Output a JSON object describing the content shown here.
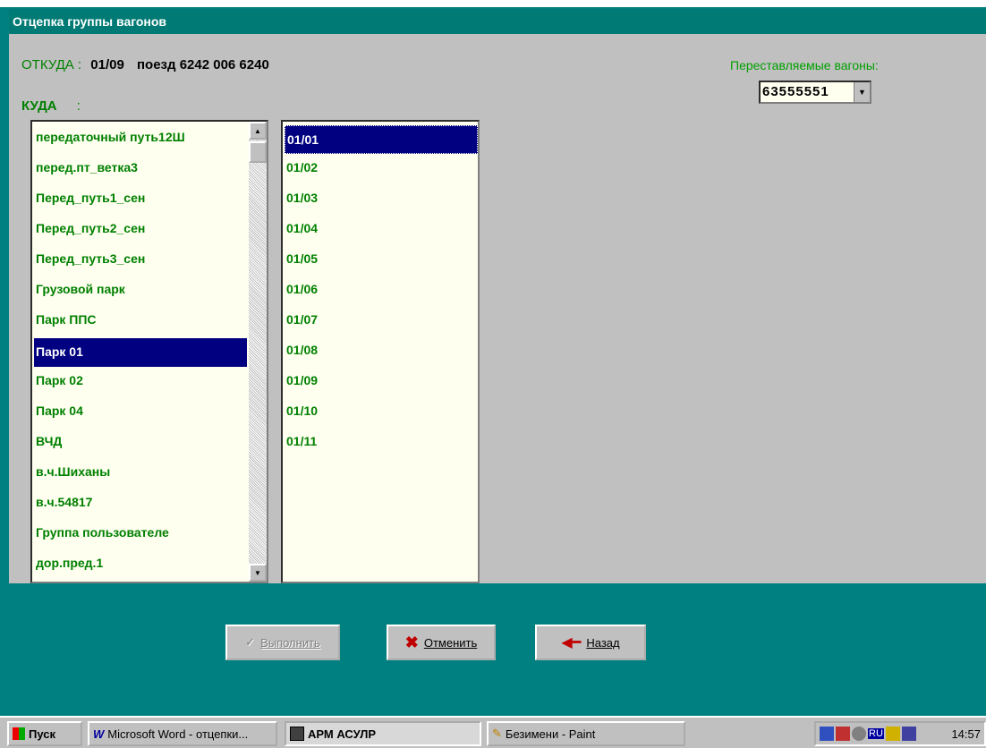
{
  "window": {
    "title": "Отцепка группы вагонов"
  },
  "header": {
    "from_label": "ОТКУДА :",
    "from_track": "01/09",
    "from_train": "поезд 6242 006 6240",
    "to_label": "КУДА",
    "to_sep": ":",
    "wagons_label": "Переставляемые вагоны:",
    "wagons_value": "63555551"
  },
  "destinations": [
    {
      "label": "передаточный путь12Ш",
      "selected": false
    },
    {
      "label": "перед.пт_ветка3",
      "selected": false
    },
    {
      "label": "Перед_путь1_сен",
      "selected": false
    },
    {
      "label": "Перед_путь2_сен",
      "selected": false
    },
    {
      "label": "Перед_путь3_сен",
      "selected": false
    },
    {
      "label": "Грузовой парк",
      "selected": false
    },
    {
      "label": "Парк ППС",
      "selected": false
    },
    {
      "label": "Парк 01",
      "selected": true
    },
    {
      "label": "Парк 02",
      "selected": false
    },
    {
      "label": "Парк 04",
      "selected": false
    },
    {
      "label": "ВЧД",
      "selected": false
    },
    {
      "label": "в.ч.Шиханы",
      "selected": false
    },
    {
      "label": "в.ч.54817",
      "selected": false
    },
    {
      "label": "Группа пользователе",
      "selected": false
    },
    {
      "label": "дор.пред.1",
      "selected": false
    }
  ],
  "tracks": [
    {
      "label": "01/01",
      "selected": true
    },
    {
      "label": "01/02",
      "selected": false
    },
    {
      "label": "01/03",
      "selected": false
    },
    {
      "label": "01/04",
      "selected": false
    },
    {
      "label": "01/05",
      "selected": false
    },
    {
      "label": "01/06",
      "selected": false
    },
    {
      "label": "01/07",
      "selected": false
    },
    {
      "label": "01/08",
      "selected": false
    },
    {
      "label": "01/09",
      "selected": false
    },
    {
      "label": "01/10",
      "selected": false
    },
    {
      "label": "01/11",
      "selected": false
    }
  ],
  "buttons": {
    "execute": "Выполнить",
    "cancel": "Отменить",
    "back": "Назад"
  },
  "taskbar": {
    "start": "Пуск",
    "tasks": [
      {
        "label": "Microsoft Word - отцепки..."
      },
      {
        "label": "АРМ АСУЛР"
      },
      {
        "label": "Безимени - Paint"
      }
    ],
    "tray_lang": "RU",
    "clock": "14:57"
  },
  "colors": {
    "window_bg": "#008080",
    "title_bg": "#007a74",
    "list_text": "#008000",
    "selection": "#000080"
  }
}
